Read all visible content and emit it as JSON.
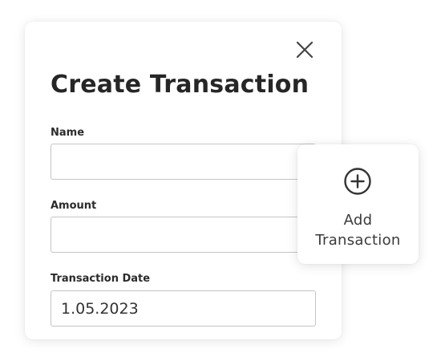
{
  "modal": {
    "title": "Create Transaction",
    "close_icon": "close-icon",
    "fields": [
      {
        "label": "Name",
        "value": "",
        "placeholder": ""
      },
      {
        "label": "Amount",
        "value": "",
        "placeholder": ""
      },
      {
        "label": "Transaction Date",
        "value": "1.05.2023",
        "placeholder": ""
      }
    ]
  },
  "add_card": {
    "icon": "plus-circle-icon",
    "label": "Add\nTransaction"
  }
}
